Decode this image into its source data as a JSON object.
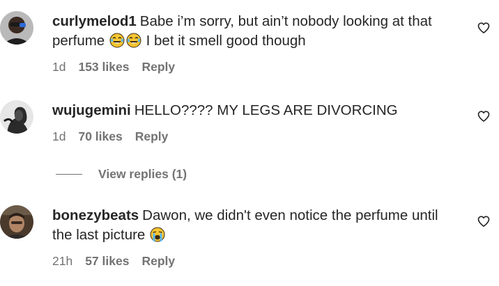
{
  "comments": [
    {
      "username": "curlymelod1",
      "text_part1": "Babe i’m sorry, but ain’t nobody looking at that perfume",
      "emoji1": "laughing-crying-emoji",
      "emoji2": "laughing-crying-emoji",
      "text_part2": "I bet it smell good though",
      "time": "1d",
      "likes": "153 likes",
      "reply_label": "Reply"
    },
    {
      "username": "wujugemini",
      "text": "HELLO???? MY LEGS ARE DIVORCING",
      "time": "1d",
      "likes": "70 likes",
      "reply_label": "Reply",
      "view_replies": "View replies (1)"
    },
    {
      "username": "bonezybeats",
      "text_part1": "Dawon, we didn't even notice the perfume until the last picture",
      "emoji1": "loudly-crying-emoji",
      "time": "21h",
      "likes": "57 likes",
      "reply_label": "Reply"
    }
  ],
  "colors": {
    "text": "#262626",
    "secondary": "#737373",
    "background": "#ffffff"
  }
}
